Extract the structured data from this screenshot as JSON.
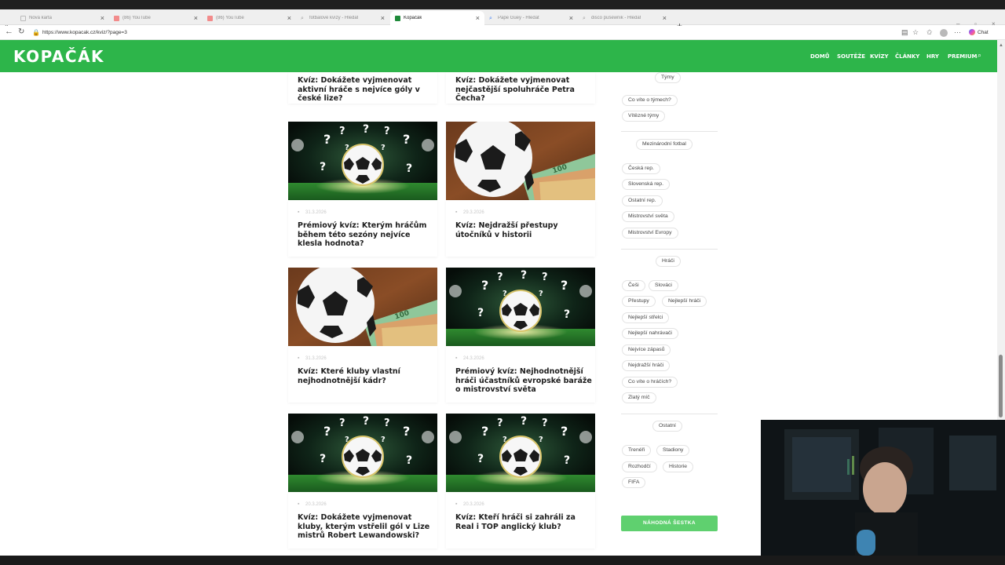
{
  "browser": {
    "tabs": [
      {
        "label": "Nová karta",
        "active": false
      },
      {
        "label": "(86) YouTube",
        "active": false
      },
      {
        "label": "(86) YouTube",
        "active": false
      },
      {
        "label": "fotbalové kvízy - Hledat",
        "active": false
      },
      {
        "label": "Kopačák",
        "active": true
      },
      {
        "label": "Pape Guey - Hledat",
        "active": false
      },
      {
        "label": "disco pušewnik - Hledat",
        "active": false
      }
    ],
    "url": "https://www.kopacak.cz/kviz/?page=3",
    "chat_label": "Chat",
    "colors": {
      "youtube": "#f28b8b",
      "kopacak_favicon": "#1f8a3a",
      "tab_strip": "#efefef"
    }
  },
  "site": {
    "logo": "KOPAČÁK",
    "nav": [
      "DOMŮ",
      "SOUTĚŽE",
      "KVÍZY",
      "ČLÁNKY",
      "HRY",
      "PREMIUM"
    ],
    "accent": "#2db54a"
  },
  "cards": [
    {
      "date": "",
      "title": "Kvíz: Dokážete vyjmenovat aktivní hráče s nejvíce góly v české lize?",
      "image": "partial"
    },
    {
      "date": "",
      "title": "Kvíz: Dokážete vyjmenovat nejčastější spoluhráče Petra Čecha?",
      "image": "partial"
    },
    {
      "date": "31.3.2026",
      "title": "Prémiový kvíz: Kterým hráčům během této sezóny nejvíce klesla hodnota?",
      "image": "stadium-question-marks"
    },
    {
      "date": "29.3.2026",
      "title": "Kvíz: Nejdražší přestupy útočníků v historii",
      "image": "ball-with-money"
    },
    {
      "date": "31.3.2026",
      "title": "Kvíz: Které kluby vlastní nejhodnotnější kádr?",
      "image": "ball-with-money"
    },
    {
      "date": "24.3.2026",
      "title": "Prémiový kvíz: Nejhodnotnější hráči účastníků evropské baráže o mistrovství světa",
      "image": "stadium-question-marks"
    },
    {
      "date": "20.3.2026",
      "title": "Kvíz: Dokážete vyjmenovat kluby, kterým vstřelil gól v Lize mistrů Robert Lewandowski?",
      "image": "stadium-question-marks"
    },
    {
      "date": "20.3.2026",
      "title": "Kvíz: Kteří hráči si zahráli za Real i TOP anglický klub?",
      "image": "stadium-question-marks"
    }
  ],
  "sidebar": {
    "sections": [
      {
        "heading": "Týmy",
        "tags": [
          "Co víte o týmech?",
          "Vítězné týmy"
        ]
      },
      {
        "heading": "Mezinárodní fotbal",
        "tags": [
          "Česká rep.",
          "Slovenská rep.",
          "Ostatní rep.",
          "Mistrovství světa",
          "Mistrovství Evropy"
        ]
      },
      {
        "heading": "Hráči",
        "tags": [
          "Češi",
          "Slováci",
          "Přestupy",
          "Nejlepší hráči",
          "Nejlepší střelci",
          "Nejlepší nahrávači",
          "Nejvíce zápasů",
          "Nejdražší hráči",
          "Co víte o hráčích?",
          "Zlatý míč"
        ]
      },
      {
        "heading": "Ostatní",
        "tags": [
          "Trenéři",
          "Stadiony",
          "Rozhodčí",
          "Historie",
          "FIFA"
        ]
      }
    ],
    "random_button": "NÁHODNÁ ŠESTKA",
    "button_color": "#5fd06f"
  }
}
